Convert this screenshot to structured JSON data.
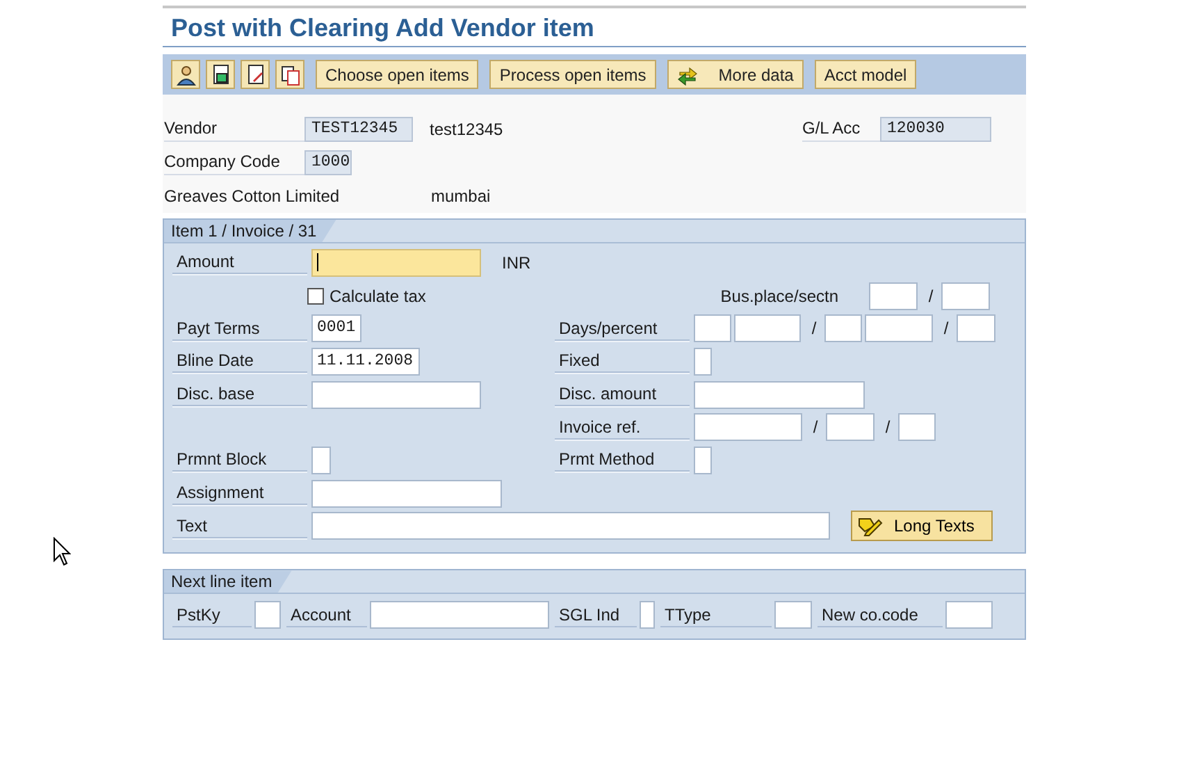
{
  "title": "Post with Clearing Add Vendor item",
  "toolbar": [
    {
      "kind": "icon"
    },
    {
      "kind": "icon"
    },
    {
      "kind": "icon"
    },
    {
      "kind": "icon"
    },
    {
      "kind": "text",
      "label": "Choose open items"
    },
    {
      "kind": "text",
      "label": "Process open items"
    },
    {
      "kind": "icon-text",
      "label": "More data"
    },
    {
      "kind": "text",
      "label": "Acct model"
    }
  ],
  "header": {
    "vendor": {
      "label": "Vendor",
      "value": "TEST12345",
      "name": "test12345"
    },
    "gl_account": {
      "label": "G/L Acc",
      "value": "120030"
    },
    "company_code": {
      "label": "Company Code",
      "value": "1000"
    },
    "company_name": "Greaves Cotton Limited",
    "city": "mumbai"
  },
  "item_panel": {
    "tab": "Item 1 / Invoice / 31",
    "rows": [
      {
        "left": {
          "kind": "input",
          "label": "Amount",
          "parts": [
            {
              "kind": "field",
              "focused": true
            }
          ],
          "suffix": "INR"
        }
      },
      {
        "left": {
          "kind": "checkbox",
          "label": "Calculate tax",
          "checked": false
        },
        "right": {
          "kind": "input",
          "label": "Bus.place/sectn",
          "parts": [
            {
              "kind": "field",
              "focused": false
            },
            {
              "kind": "sep",
              "text": "/"
            },
            {
              "kind": "field",
              "focused": false
            }
          ]
        }
      },
      {
        "left": {
          "kind": "input",
          "label": "Payt Terms",
          "parts": [
            {
              "kind": "field",
              "value": "0001",
              "focused": false
            }
          ]
        },
        "right": {
          "kind": "input",
          "label": "Days/percent",
          "parts": [
            {
              "kind": "field",
              "focused": false
            },
            {
              "kind": "field",
              "focused": false
            },
            {
              "kind": "sep",
              "text": "/"
            },
            {
              "kind": "field",
              "focused": false
            },
            {
              "kind": "field",
              "focused": false
            },
            {
              "kind": "sep",
              "text": "/"
            },
            {
              "kind": "field",
              "focused": false
            }
          ]
        }
      },
      {
        "left": {
          "kind": "input",
          "label": "Bline Date",
          "parts": [
            {
              "kind": "field",
              "value": "11.11.2008",
              "focused": false
            }
          ]
        },
        "right": {
          "kind": "input",
          "label": "Fixed",
          "parts": [
            {
              "kind": "field",
              "focused": false
            }
          ]
        }
      },
      {
        "left": {
          "kind": "input",
          "label": "Disc. base",
          "parts": [
            {
              "kind": "field",
              "focused": false
            }
          ]
        },
        "right": {
          "kind": "input",
          "label": "Disc. amount",
          "parts": [
            {
              "kind": "field",
              "focused": false
            }
          ]
        }
      },
      {
        "right": {
          "kind": "input",
          "label": "Invoice ref.",
          "parts": [
            {
              "kind": "field",
              "focused": false
            },
            {
              "kind": "sep",
              "text": "/"
            },
            {
              "kind": "field",
              "focused": false
            },
            {
              "kind": "sep",
              "text": "/"
            },
            {
              "kind": "field",
              "focused": false
            }
          ]
        }
      },
      {
        "left": {
          "kind": "input",
          "label": "Prmnt Block",
          "parts": [
            {
              "kind": "field",
              "focused": false
            }
          ]
        },
        "right": {
          "kind": "input",
          "label": "Prmt Method",
          "parts": [
            {
              "kind": "field",
              "focused": false
            }
          ]
        }
      },
      {
        "left": {
          "kind": "input",
          "label": "Assignment",
          "parts": [
            {
              "kind": "field",
              "focused": false
            }
          ]
        }
      },
      {
        "left": {
          "kind": "input",
          "label": "Text",
          "parts": [
            {
              "kind": "field",
              "focused": false
            }
          ]
        },
        "button": {
          "label": "Long Texts"
        }
      }
    ]
  },
  "next_item_panel": {
    "tab": "Next line item",
    "fields": [
      {
        "label": "PstKy"
      },
      {
        "label": "Account"
      },
      {
        "label": "SGL Ind"
      },
      {
        "label": "TType"
      },
      {
        "label": "New co.code"
      }
    ]
  }
}
